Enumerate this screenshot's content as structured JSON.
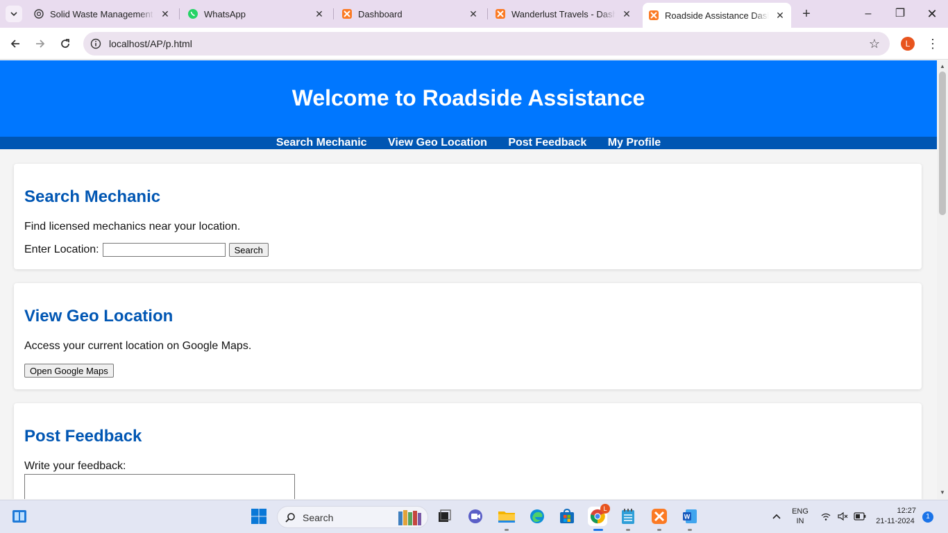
{
  "browser": {
    "tabs": [
      {
        "title": "Solid Waste Management Sy",
        "icon": "chatgpt-icon"
      },
      {
        "title": "WhatsApp",
        "icon": "whatsapp-icon"
      },
      {
        "title": "Dashboard",
        "icon": "xampp-icon"
      },
      {
        "title": "Wanderlust Travels - Dashbo",
        "icon": "xampp-icon"
      },
      {
        "title": "Roadside Assistance Dashbo",
        "icon": "xampp-icon",
        "active": true
      }
    ],
    "url": "localhost/AP/p.html",
    "profile_initial": "L"
  },
  "page": {
    "header_title": "Welcome to Roadside Assistance",
    "nav": [
      "Search Mechanic",
      "View Geo Location",
      "Post Feedback",
      "My Profile"
    ],
    "search_section": {
      "heading": "Search Mechanic",
      "description": "Find licensed mechanics near your location.",
      "location_label": "Enter Location:",
      "location_value": "",
      "search_button": "Search"
    },
    "geo_section": {
      "heading": "View Geo Location",
      "description": "Access your current location on Google Maps.",
      "maps_button": "Open Google Maps"
    },
    "feedback_section": {
      "heading": "Post Feedback",
      "prompt": "Write your feedback:",
      "feedback_value": ""
    }
  },
  "taskbar": {
    "search_label": "Search",
    "chrome_badge": "L",
    "language": "ENG",
    "region": "IN",
    "time": "12:27",
    "date": "21-11-2024",
    "notification_count": "1"
  },
  "colors": {
    "header_blue": "#0077ff",
    "nav_blue": "#0056b3",
    "heading_blue": "#0056b3"
  }
}
